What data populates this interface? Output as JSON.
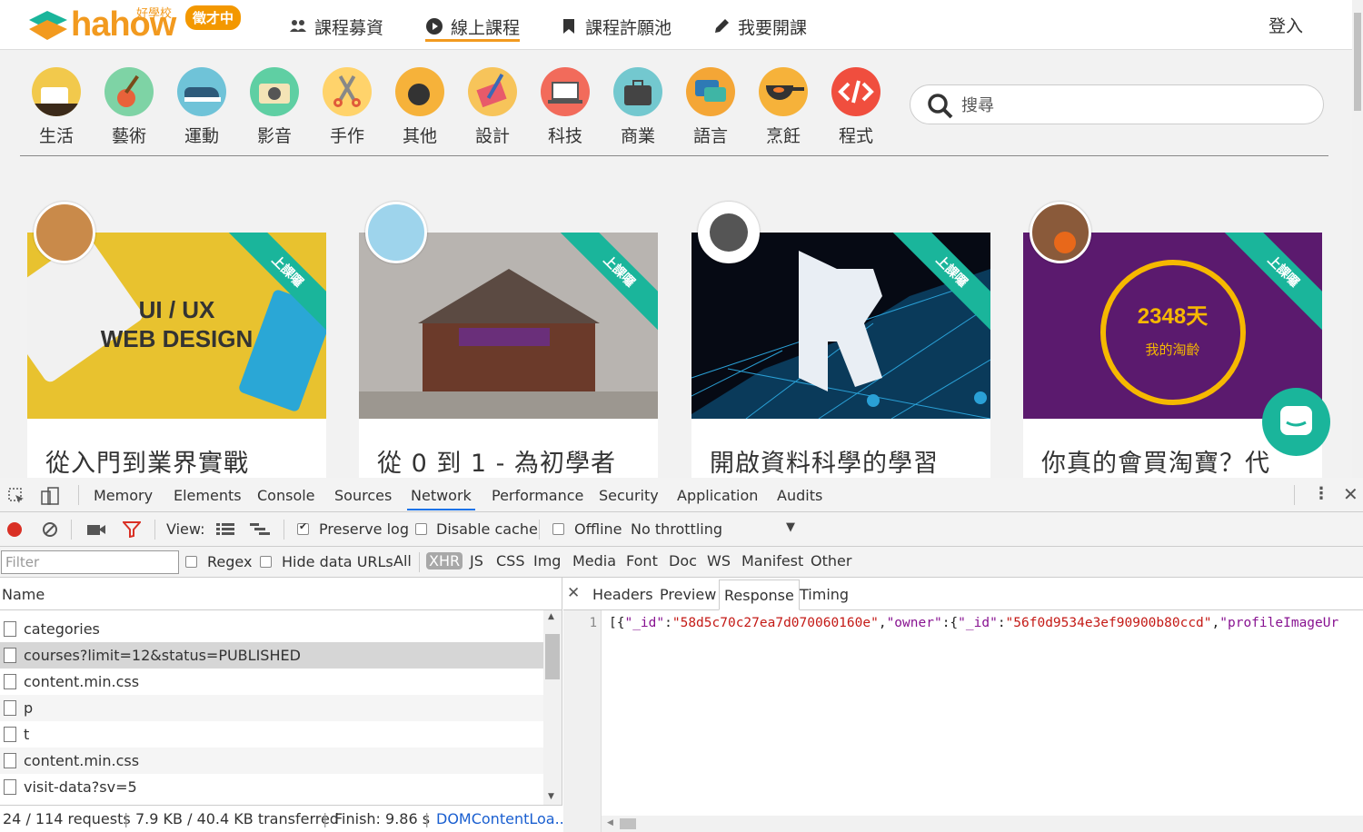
{
  "site": {
    "logo": {
      "word": "hahow",
      "sub": "好學校",
      "badge": "徵才中"
    },
    "nav": [
      {
        "label": "課程募資",
        "icon": "people-icon"
      },
      {
        "label": "線上課程",
        "icon": "play-icon",
        "active": true
      },
      {
        "label": "課程許願池",
        "icon": "bookmark-icon"
      },
      {
        "label": "我要開課",
        "icon": "pencil-icon"
      }
    ],
    "login": "登入",
    "categories": [
      {
        "label": "生活",
        "icon": "coffee-icon",
        "color": "#f2c94c"
      },
      {
        "label": "藝術",
        "icon": "guitar-icon",
        "color": "#7ed3a5"
      },
      {
        "label": "運動",
        "icon": "sneaker-icon",
        "color": "#6fc3d8"
      },
      {
        "label": "影音",
        "icon": "camera-icon",
        "color": "#5fcfa3"
      },
      {
        "label": "手作",
        "icon": "scissors-icon",
        "color": "#ffd36b"
      },
      {
        "label": "其他",
        "icon": "bomb-icon",
        "color": "#f6b23a"
      },
      {
        "label": "設計",
        "icon": "design-tools-icon",
        "color": "#f7c45a"
      },
      {
        "label": "科技",
        "icon": "laptop-icon",
        "color": "#f26b5b"
      },
      {
        "label": "商業",
        "icon": "briefcase-icon",
        "color": "#73c8cf"
      },
      {
        "label": "語言",
        "icon": "speech-bubble-icon",
        "color": "#f4a636"
      },
      {
        "label": "烹飪",
        "icon": "pan-icon",
        "color": "#f6b23a"
      },
      {
        "label": "程式",
        "icon": "code-icon",
        "color": "#f04e3e"
      }
    ],
    "search_placeholder": "搜尋",
    "ribbon": "上課囉",
    "courses": [
      {
        "title": "從入門到業界實戰",
        "image_text_1": "UI / UX",
        "image_text_2": "WEB DESIGN"
      },
      {
        "title": "從 0 到 1 - 為初學者"
      },
      {
        "title": "開啟資料科學的學習"
      },
      {
        "title": "你真的會買淘寶？代",
        "image_text_1": "2348天",
        "image_text_2": "我的淘齡"
      }
    ]
  },
  "devtools": {
    "tabs": [
      "Memory",
      "Elements",
      "Console",
      "Sources",
      "Network",
      "Performance",
      "Security",
      "Application",
      "Audits"
    ],
    "active_tab": "Network",
    "toolbar": {
      "view_label": "View:",
      "preserve_log": "Preserve log",
      "disable_cache": "Disable cache",
      "offline": "Offline",
      "throttling": "No throttling"
    },
    "filter": {
      "placeholder": "Filter",
      "regex": "Regex",
      "hide_data_urls": "Hide data URLs",
      "types": [
        "All",
        "XHR",
        "JS",
        "CSS",
        "Img",
        "Media",
        "Font",
        "Doc",
        "WS",
        "Manifest",
        "Other"
      ],
      "active_type": "XHR"
    },
    "requests_header": "Name",
    "requests": [
      "categories",
      "courses?limit=12&status=PUBLISHED",
      "content.min.css",
      "p",
      "t",
      "content.min.css",
      "visit-data?sv=5"
    ],
    "selected_request": 1,
    "detail_tabs": [
      "Headers",
      "Preview",
      "Response",
      "Timing"
    ],
    "active_detail_tab": "Response",
    "response": {
      "line_number": "1",
      "p1": "[{",
      "k1": "\"_id\"",
      "c1": ":",
      "v1": "\"58d5c70c27ea7d070060160e\"",
      "c2": ",",
      "k2": "\"owner\"",
      "c3": ":{",
      "k3": "\"_id\"",
      "c4": ":",
      "v2": "\"56f0d9534e3ef90900b80ccd\"",
      "c5": ",",
      "k4": "\"profileImageUr"
    },
    "status": {
      "requests": "24 / 114 requests",
      "transferred": "7.9 KB / 40.4 KB transferred",
      "finish": "Finish: 9.86 s",
      "dcl": "DOMContentLoa..."
    }
  }
}
